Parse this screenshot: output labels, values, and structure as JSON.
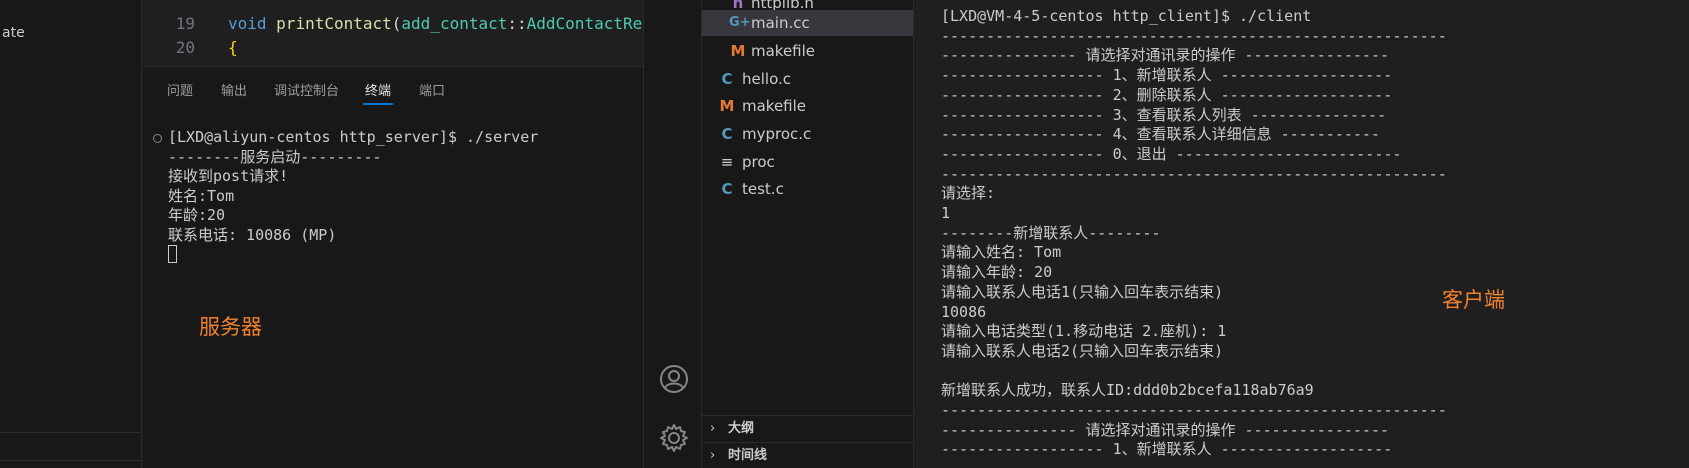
{
  "left_panel": {
    "fragment": "ate"
  },
  "editor": {
    "lines": [
      {
        "num": "19",
        "keyword": "void",
        "func": "printContact",
        "open": "(",
        "ns": "add_contact",
        "sep": "::",
        "type": "AddContactReq"
      },
      {
        "num": "20",
        "brace": "{"
      }
    ]
  },
  "panel_tabs": [
    {
      "label": "问题"
    },
    {
      "label": "输出"
    },
    {
      "label": "调试控制台"
    },
    {
      "label": "终端"
    },
    {
      "label": "端口"
    }
  ],
  "server_terminal": {
    "lines": [
      "[LXD@aliyun-centos http_server]$ ./server",
      "--------服务启动---------",
      "接收到post请求!",
      "姓名:Tom",
      "年龄:20",
      "联系电话: 10086 (MP)"
    ]
  },
  "server_label": "服务器",
  "explorer": {
    "files": [
      {
        "name": "httplib.h",
        "icon": "h-file-icon",
        "indent": 2
      },
      {
        "name": "main.cc",
        "icon": "cpp-file-icon",
        "indent": 2,
        "selected": true
      },
      {
        "name": "makefile",
        "icon": "makefile-icon",
        "indent": 2
      },
      {
        "name": "hello.c",
        "icon": "c-file-icon",
        "indent": 1
      },
      {
        "name": "makefile",
        "icon": "makefile-icon",
        "indent": 1
      },
      {
        "name": "myproc.c",
        "icon": "c-file-icon",
        "indent": 1
      },
      {
        "name": "proc",
        "icon": "plain-file-icon",
        "indent": 1
      },
      {
        "name": "test.c",
        "icon": "c-file-icon",
        "indent": 1
      }
    ],
    "sections": [
      {
        "label": "大纲"
      },
      {
        "label": "时间线"
      }
    ]
  },
  "client_terminal": {
    "lines": [
      "[LXD@VM-4-5-centos http_client]$ ./client",
      "--------------------------------------------------------",
      "--------------- 请选择对通讯录的操作 ----------------",
      "------------------ 1、新增联系人 -------------------",
      "------------------ 2、删除联系人 -------------------",
      "------------------ 3、查看联系人列表 ---------------",
      "------------------ 4、查看联系人详细信息 -----------",
      "------------------ 0、退出 -------------------------",
      "--------------------------------------------------------",
      "请选择:",
      "1",
      "--------新增联系人--------",
      "请输入姓名: Tom",
      "请输入年龄: 20",
      "请输入联系人电话1(只输入回车表示结束)",
      "10086",
      "请输入电话类型(1.移动电话 2.座机): 1",
      "请输入联系人电话2(只输入回车表示结束)",
      "",
      "新增联系人成功，联系人ID:ddd0b2bcefa118ab76a9",
      "--------------------------------------------------------",
      "--------------- 请选择对通讯录的操作 ----------------",
      "------------------ 1、新增联系人 -------------------"
    ]
  },
  "client_label": "客户端",
  "colors": {
    "accent": "#0078d4",
    "annotation": "#f0822d"
  }
}
